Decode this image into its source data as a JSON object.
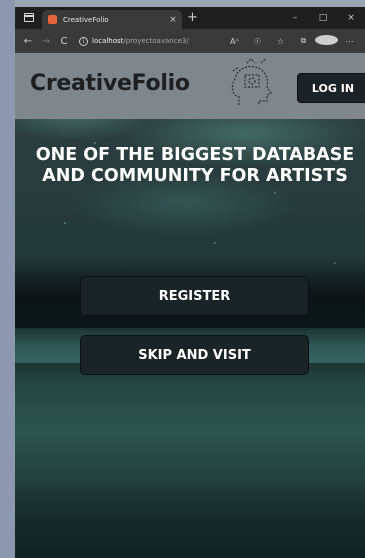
{
  "browser": {
    "tab_title": "CreativeFolio",
    "tab_close": "×",
    "new_tab": "+",
    "window_controls": [
      "–",
      "□",
      "×"
    ],
    "nav": {
      "back": "←",
      "forward": "→",
      "reload": "C"
    },
    "url_host": "localhost",
    "url_path": "/proyectoavance3/",
    "toolbar_icons": [
      "Aᴬ",
      "☉",
      "☆",
      "⧉",
      "●",
      "⋯"
    ]
  },
  "header": {
    "logo_text": "CreativeFolio",
    "login_label": "LOG IN"
  },
  "hero": {
    "title": "ONE OF THE BIGGEST DATABASE AND COMMUNITY FOR ARTISTS"
  },
  "actions": {
    "register_label": "REGISTER",
    "skip_label": "SKIP AND VISIT"
  },
  "colors": {
    "header_bg": "#7f868c",
    "button_bg": "#1a2427",
    "logo_text": "#1d2023"
  }
}
